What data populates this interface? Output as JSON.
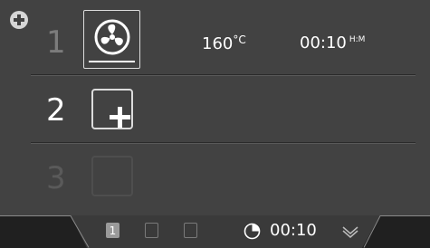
{
  "rows": [
    {
      "number": "1",
      "temperature": "160",
      "temperature_unit": "°C",
      "time": "00:10",
      "time_unit": "H:M"
    },
    {
      "number": "2"
    },
    {
      "number": "3"
    }
  ],
  "footer": {
    "pages": [
      "1",
      "",
      ""
    ],
    "active_page": 1,
    "remaining_time": "00:10"
  },
  "icons": {
    "add": "plus-circle-icon",
    "fan": "fan-icon",
    "timer": "timer-icon",
    "more": "chevron-down-icon"
  },
  "colors": {
    "background": "#424242",
    "text": "#ffffff",
    "disabled_text": "#5a5a5a",
    "footer_bg": "#202020"
  }
}
